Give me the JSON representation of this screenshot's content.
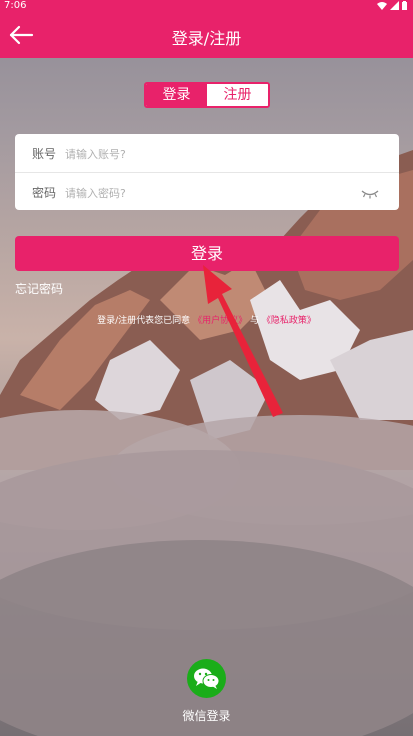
{
  "status_bar": {
    "time": "7:06"
  },
  "header": {
    "title": "登录/注册",
    "back_icon": "back-arrow-icon"
  },
  "tabs": [
    {
      "label": "登录",
      "active": true
    },
    {
      "label": "注册",
      "active": false
    }
  ],
  "form": {
    "account": {
      "label": "账号",
      "placeholder": "请输入账号?"
    },
    "password": {
      "label": "密码",
      "placeholder": "请输入密码?"
    }
  },
  "login_button": {
    "label": "登录"
  },
  "forgot_password": {
    "label": "忘记密码"
  },
  "agreement": {
    "prefix": "登录/注册代表您已同意",
    "user_agreement": "《用户协议》",
    "conjunction": "与",
    "privacy_policy": "《隐私政策》"
  },
  "wechat_login": {
    "label": "微信登录"
  },
  "colors": {
    "accent": "#e8226a",
    "wechat": "#1aad19",
    "annotation": "#e8233a"
  }
}
